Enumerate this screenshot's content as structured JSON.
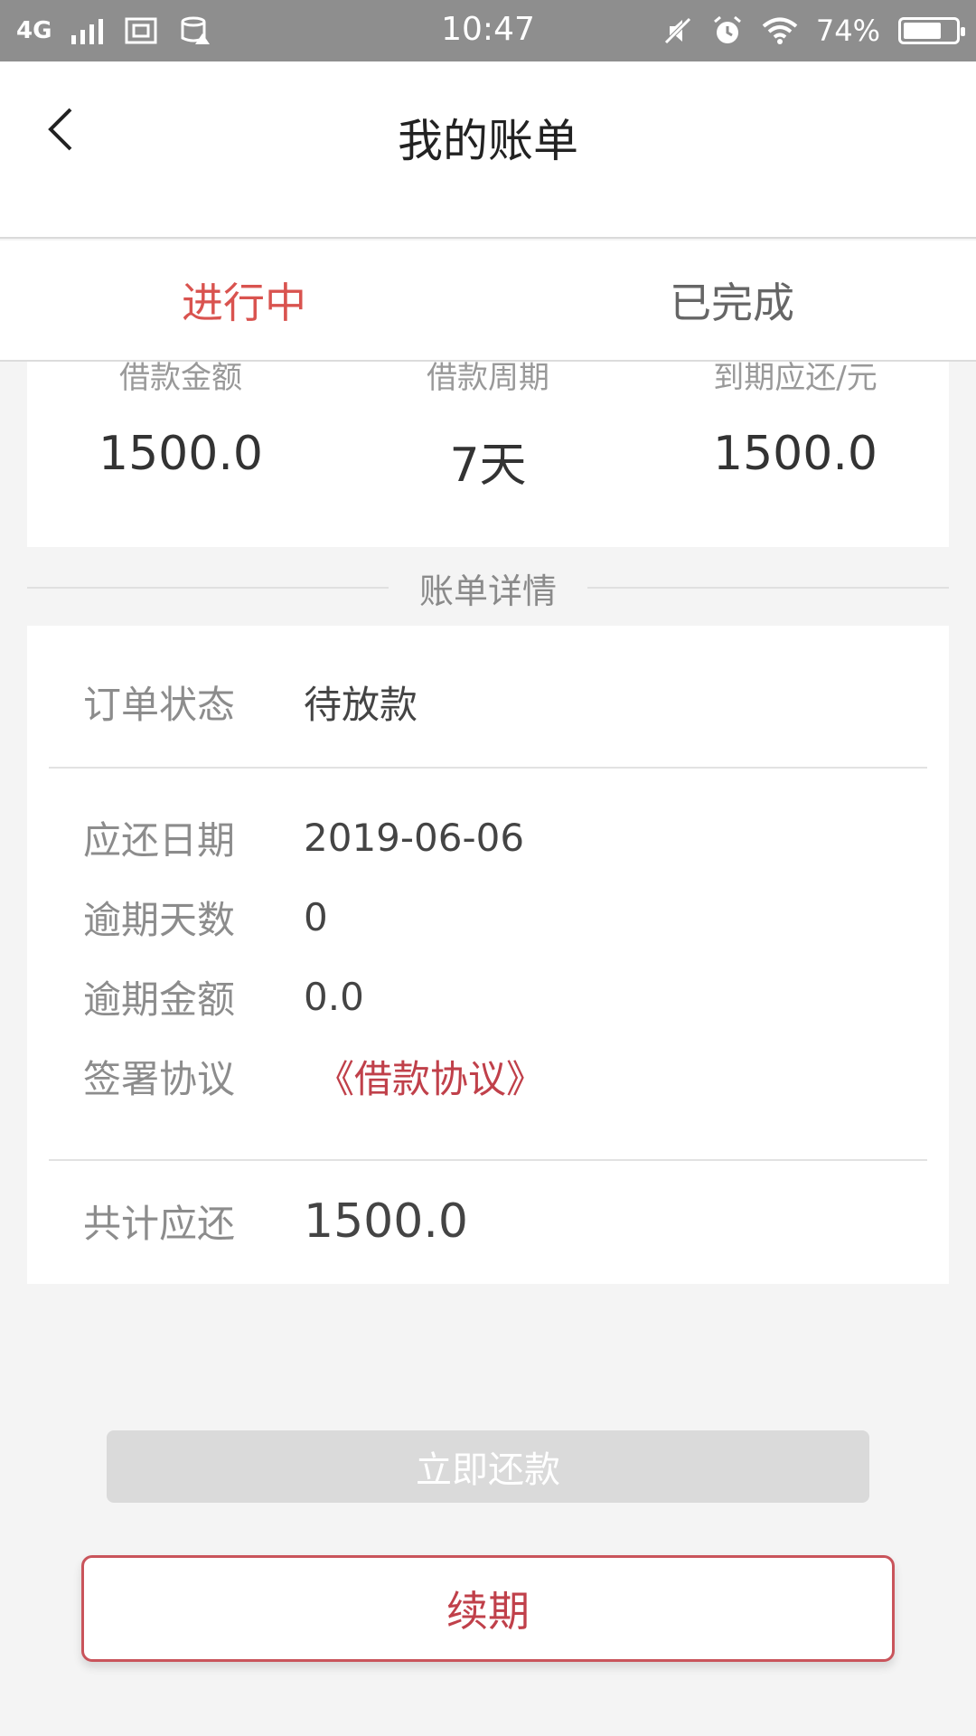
{
  "status_bar": {
    "network": "4G",
    "time": "10:47",
    "battery": "74%",
    "battery_level": 0.74,
    "icons": [
      "signal-icon",
      "screenshot-icon",
      "storage-alert-icon",
      "mute-icon",
      "alarm-icon",
      "wifi-icon",
      "battery-icon"
    ]
  },
  "header": {
    "title": "我的账单",
    "back_icon": "chevron-left-icon"
  },
  "tabs": [
    {
      "label": "进行中",
      "active": true
    },
    {
      "label": "已完成",
      "active": false
    }
  ],
  "summary": [
    {
      "label": "借款金额",
      "value": "1500.0"
    },
    {
      "label": "借款周期",
      "value": "7天"
    },
    {
      "label": "到期应还/元",
      "value": "1500.0"
    }
  ],
  "section_title": "账单详情",
  "details": {
    "status": {
      "label": "订单状态",
      "value": "待放款"
    },
    "due_date": {
      "label": "应还日期",
      "value": "2019-06-06"
    },
    "overdue_days": {
      "label": "逾期天数",
      "value": "0"
    },
    "overdue_amount": {
      "label": "逾期金额",
      "value": "0.0"
    },
    "agreement": {
      "label": "签署协议",
      "value": "《借款协议》"
    },
    "total": {
      "label": "共计应还",
      "value": "1500.0"
    }
  },
  "buttons": {
    "repay": "立即还款",
    "renew": "续期"
  },
  "colors": {
    "accent": "#d9534f",
    "link": "#c0404a",
    "disabled_button": "#dadada",
    "background": "#f4f4f4"
  }
}
